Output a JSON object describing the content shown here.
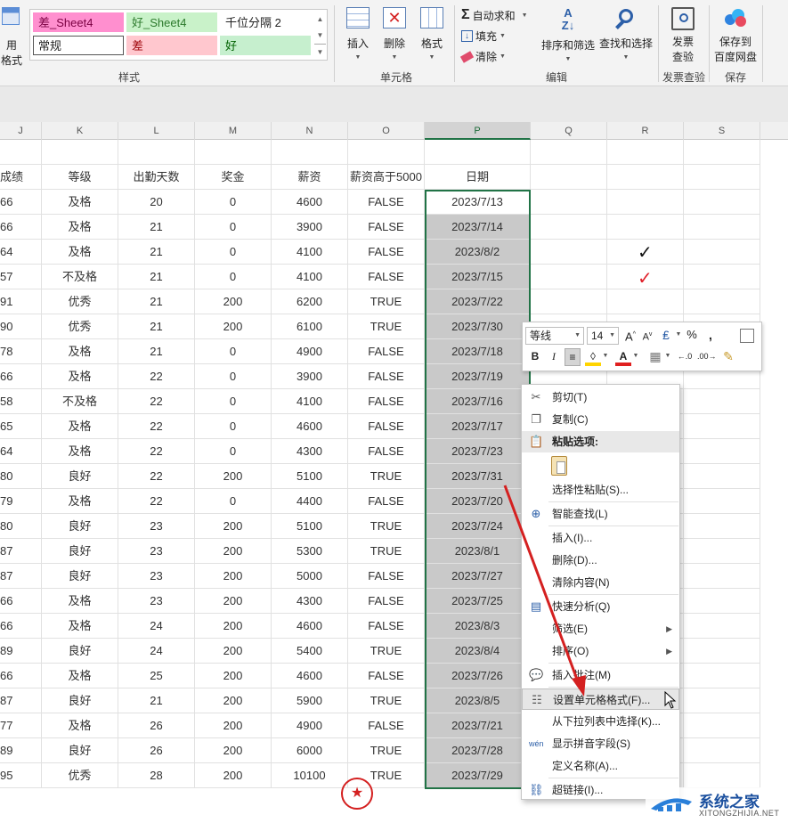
{
  "ribbon": {
    "cond_format_label_1": "用",
    "cond_format_label_2": "格式",
    "styles": {
      "bad_sheet4": "差_Sheet4",
      "good_sheet4": "好_Sheet4",
      "thousands_sep_2": "千位分隔 2",
      "normal": "常规",
      "bad": "差",
      "good": "好"
    },
    "groups": {
      "styles": "样式",
      "cells": "单元格",
      "editing": "编辑",
      "invoice": "发票查验",
      "save": "保存"
    },
    "buttons": {
      "insert": "插入",
      "delete": "删除",
      "format": "格式",
      "autosum": "自动求和",
      "fill": "填充",
      "clear": "清除",
      "sort_filter": "排序和筛选",
      "find_select": "查找和选择",
      "invoice_1": "发票",
      "invoice_2": "查验",
      "save_1": "保存到",
      "save_2": "百度网盘"
    }
  },
  "columns": [
    "J",
    "K",
    "L",
    "M",
    "N",
    "O",
    "P",
    "Q",
    "R",
    "S"
  ],
  "headers": [
    "成绩",
    "等级",
    "出勤天数",
    "奖金",
    "薪资",
    "薪资高于5000",
    "日期"
  ],
  "rows": [
    [
      "66",
      "及格",
      "20",
      "0",
      "4600",
      "FALSE",
      "2023/7/13"
    ],
    [
      "66",
      "及格",
      "21",
      "0",
      "3900",
      "FALSE",
      "2023/7/14"
    ],
    [
      "64",
      "及格",
      "21",
      "0",
      "4100",
      "FALSE",
      "2023/8/2"
    ],
    [
      "57",
      "不及格",
      "21",
      "0",
      "4100",
      "FALSE",
      "2023/7/15"
    ],
    [
      "91",
      "优秀",
      "21",
      "200",
      "6200",
      "TRUE",
      "2023/7/22"
    ],
    [
      "90",
      "优秀",
      "21",
      "200",
      "6100",
      "TRUE",
      "2023/7/30"
    ],
    [
      "78",
      "及格",
      "21",
      "0",
      "4900",
      "FALSE",
      "2023/7/18"
    ],
    [
      "66",
      "及格",
      "22",
      "0",
      "3900",
      "FALSE",
      "2023/7/19"
    ],
    [
      "58",
      "不及格",
      "22",
      "0",
      "4100",
      "FALSE",
      "2023/7/16"
    ],
    [
      "65",
      "及格",
      "22",
      "0",
      "4600",
      "FALSE",
      "2023/7/17"
    ],
    [
      "64",
      "及格",
      "22",
      "0",
      "4300",
      "FALSE",
      "2023/7/23"
    ],
    [
      "80",
      "良好",
      "22",
      "200",
      "5100",
      "TRUE",
      "2023/7/31"
    ],
    [
      "79",
      "及格",
      "22",
      "0",
      "4400",
      "FALSE",
      "2023/7/20"
    ],
    [
      "80",
      "良好",
      "23",
      "200",
      "5100",
      "TRUE",
      "2023/7/24"
    ],
    [
      "87",
      "良好",
      "23",
      "200",
      "5300",
      "TRUE",
      "2023/8/1"
    ],
    [
      "87",
      "良好",
      "23",
      "200",
      "5000",
      "FALSE",
      "2023/7/27"
    ],
    [
      "66",
      "及格",
      "23",
      "200",
      "4300",
      "FALSE",
      "2023/7/25"
    ],
    [
      "66",
      "及格",
      "24",
      "200",
      "4600",
      "FALSE",
      "2023/8/3"
    ],
    [
      "89",
      "良好",
      "24",
      "200",
      "5400",
      "TRUE",
      "2023/8/4"
    ],
    [
      "66",
      "及格",
      "25",
      "200",
      "4600",
      "FALSE",
      "2023/7/26"
    ],
    [
      "87",
      "良好",
      "21",
      "200",
      "5900",
      "TRUE",
      "2023/8/5"
    ],
    [
      "77",
      "及格",
      "26",
      "200",
      "4900",
      "FALSE",
      "2023/7/21"
    ],
    [
      "89",
      "良好",
      "26",
      "200",
      "6000",
      "TRUE",
      "2023/7/28"
    ],
    [
      "95",
      "优秀",
      "28",
      "200",
      "10100",
      "TRUE",
      "2023/7/29"
    ]
  ],
  "marks": {
    "black_check": "✓",
    "red_check": "✓"
  },
  "mini_toolbar": {
    "font": "等线",
    "size": "14"
  },
  "context_menu": [
    {
      "label": "剪切(T)",
      "icon": "scissors-icon"
    },
    {
      "label": "复制(C)",
      "icon": "copy-icon"
    },
    {
      "label": "粘贴选项:",
      "icon": "paste-icon"
    },
    {
      "label": "选择性粘贴(S)...",
      "icon": ""
    },
    {
      "label": "智能查找(L)",
      "icon": "smart-lookup-icon"
    },
    {
      "label": "插入(I)...",
      "icon": ""
    },
    {
      "label": "删除(D)...",
      "icon": ""
    },
    {
      "label": "清除内容(N)",
      "icon": ""
    },
    {
      "label": "快速分析(Q)",
      "icon": "quick-analysis-icon"
    },
    {
      "label": "筛选(E)",
      "icon": ""
    },
    {
      "label": "排序(O)",
      "icon": ""
    },
    {
      "label": "插入批注(M)",
      "icon": "comment-icon"
    },
    {
      "label": "设置单元格格式(F)...",
      "icon": "format-cells-icon"
    },
    {
      "label": "从下拉列表中选择(K)...",
      "icon": ""
    },
    {
      "label": "显示拼音字段(S)",
      "icon": "pinyin-icon"
    },
    {
      "label": "定义名称(A)...",
      "icon": ""
    },
    {
      "label": "超链接(I)...",
      "icon": "hyperlink-icon"
    }
  ],
  "watermark": {
    "name": "系统之家",
    "url": "XITONGZHIJIA.NET"
  },
  "colors": {
    "accent": "#217346",
    "arrow": "#d42020",
    "selection": "#c9c9c9"
  }
}
